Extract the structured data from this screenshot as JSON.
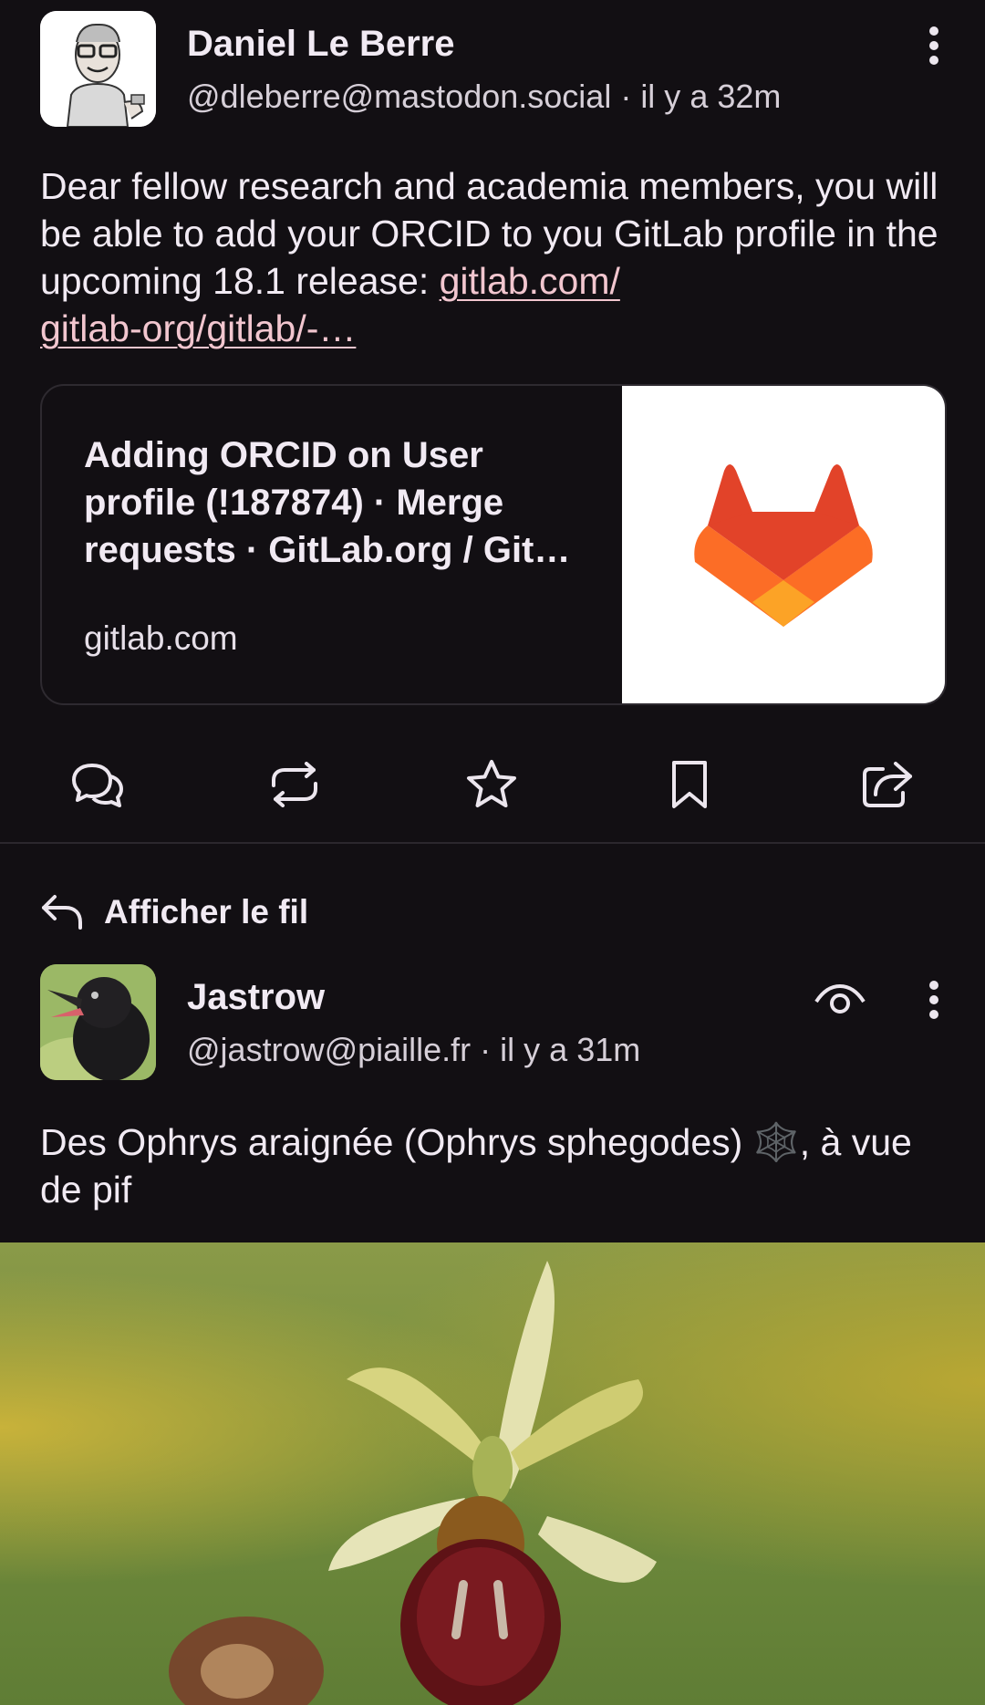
{
  "colors": {
    "background": "#120f13",
    "text": "#f1eaf3",
    "link": "#f2c6cf",
    "divider": "#2b272d",
    "gitlab_orange_dark": "#e24329",
    "gitlab_orange": "#fc6d26",
    "gitlab_orange_light": "#fca326"
  },
  "post1": {
    "author_name": "Daniel Le Berre",
    "handle": "@dleberre@mastodon.social",
    "separator": " · ",
    "time": "il y a 32m",
    "text": "Dear fellow research and academia members, you will be able to add your ORCID to you GitLab profile in the upcoming 18.1 release: ",
    "link_line1": "gitlab.com/",
    "link_line2": "gitlab-org/gitlab/-…",
    "card": {
      "title": "Adding ORCID on User profile (!187874) · Merge requests · GitLab.org / Git…",
      "domain": "gitlab.com"
    },
    "menu_icon": "more-vert-icon",
    "actions": [
      "reply-icon",
      "boost-icon",
      "favourite-icon",
      "bookmark-icon",
      "share-icon"
    ]
  },
  "thread_link": {
    "label": "Afficher le fil",
    "icon": "reply-arrow-icon"
  },
  "post2": {
    "author_name": "Jastrow",
    "handle": "@jastrow@piaille.fr",
    "separator": " · ",
    "time": "il y a 31m",
    "text": "Des Ophrys araignée (Ophrys sphegodes) 🕸️, à vue de pif",
    "visibility_icon": "eye-icon",
    "menu_icon": "more-vert-icon",
    "media_icon": "photo-orchid"
  }
}
